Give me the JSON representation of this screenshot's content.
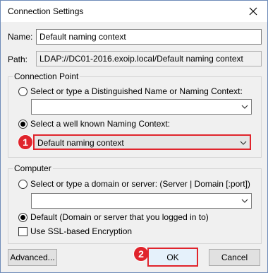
{
  "window": {
    "title": "Connection Settings"
  },
  "name_field": {
    "label": "Name:",
    "value": "Default naming context"
  },
  "path_field": {
    "label": "Path:",
    "value": "LDAP://DC01-2016.exoip.local/Default naming context"
  },
  "connection_point": {
    "group_title": "Connection Point",
    "option_dn_label": "Select or type a Distinguished Name or Naming Context:",
    "dn_combo_value": "",
    "option_wellknown_label": "Select a well known Naming Context:",
    "wellknown_combo_value": "Default naming context",
    "badge": "1"
  },
  "computer": {
    "group_title": "Computer",
    "option_server_label": "Select or type a domain or server: (Server | Domain [:port])",
    "server_combo_value": "",
    "option_default_label": "Default (Domain or server that you logged in to)",
    "ssl_label": "Use SSL-based Encryption"
  },
  "buttons": {
    "advanced": "Advanced...",
    "ok": "OK",
    "cancel": "Cancel",
    "ok_badge": "2"
  },
  "colors": {
    "highlight": "#e0242c",
    "window_bg": "#f0f0f0"
  }
}
